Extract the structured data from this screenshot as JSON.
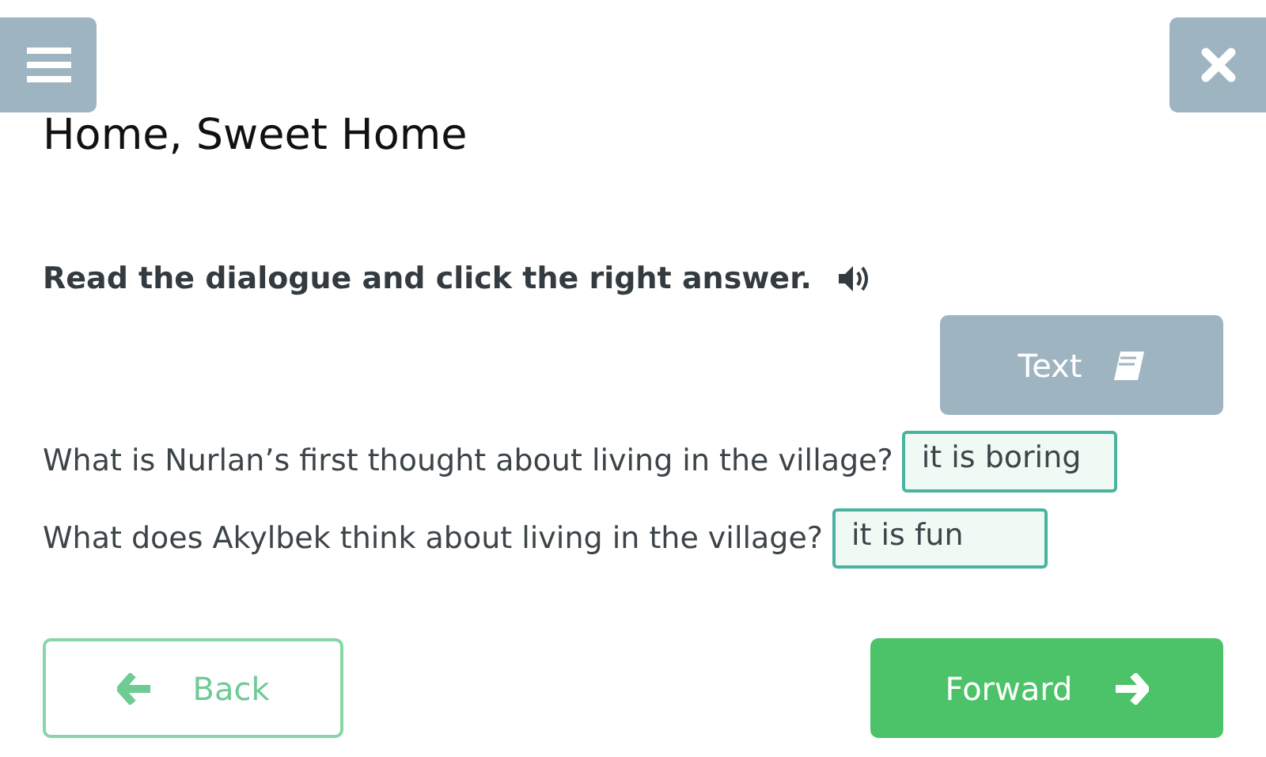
{
  "title": "Home, Sweet Home",
  "instruction": "Read the dialogue and click the right answer.",
  "text_button": "Text",
  "questions": [
    {
      "question": "What is Nurlan’s first thought about living in the village?",
      "answer": "it is boring"
    },
    {
      "question": "What does Akylbek think about living in the village?",
      "answer": "it is fun"
    }
  ],
  "back_button": "Back",
  "forward_button": "Forward"
}
